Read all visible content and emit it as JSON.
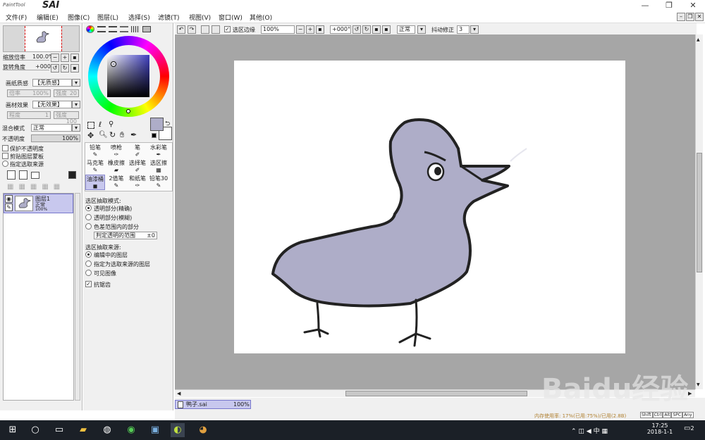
{
  "app": {
    "logo_small": "PaintTool",
    "logo_big": "SAI"
  },
  "window": {
    "min": "—",
    "restore": "❐",
    "close": "✕"
  },
  "menu": [
    "文件(F)",
    "编辑(E)",
    "图像(C)",
    "图层(L)",
    "选择(S)",
    "滤镜(T)",
    "视图(V)",
    "窗口(W)",
    "其他(O)"
  ],
  "navigator": {
    "zoom_label": "缩放倍率",
    "zoom_value": "100.0%",
    "rotate_label": "旋转角度",
    "rotate_value": "+000"
  },
  "paper": {
    "texture_label": "画纸质感",
    "texture_value": "【无质感】",
    "t_scale_label": "倍率",
    "t_scale_value": "100%",
    "t_strength_label": "强度",
    "t_strength_value": "20",
    "effect_label": "画材效果",
    "effect_value": "【无效果】",
    "e_degree_label": "程度",
    "e_degree_value": "1",
    "e_strength_label": "强度",
    "e_strength_value": "100"
  },
  "layer_props": {
    "blend_label": "混合模式",
    "blend_value": "正常",
    "opacity_label": "不透明度",
    "opacity_value": "100%",
    "opt1": "保护不透明度",
    "opt2": "剪贴图层蒙板",
    "opt3": "指定选取来源"
  },
  "layer": {
    "name": "图层1",
    "mode": "正常",
    "opacity": "100%"
  },
  "tools": [
    [
      "铅笔",
      "喷枪",
      "笔",
      "水彩笔"
    ],
    [
      "马克笔",
      "橡皮擦",
      "选择笔",
      "选区擦"
    ],
    [
      "油漆桶",
      "2值笔",
      "和纸笔",
      "铅笔30"
    ]
  ],
  "selection": {
    "mode_title": "选区抽取模式:",
    "mode1": "透明部分(精确)",
    "mode2": "透明部分(模糊)",
    "mode3": "色差范围内的部分",
    "range_label": "判定透明的范围",
    "range_value": "±0",
    "source_title": "选区抽取来源:",
    "src1": "编辑中的图层",
    "src2": "指定为选取来源的图层",
    "src3": "可见图像",
    "antialias": "抗锯齿"
  },
  "toolbar": {
    "sel_edge": "选区边缘",
    "zoom": "100%",
    "angle": "+000°",
    "mode": "正常",
    "stab_label": "抖动修正",
    "stab_value": "3"
  },
  "doc_tab": {
    "name": "鸭子.sai",
    "zoom": "100%"
  },
  "status": {
    "mem": "内存使用率: 17%(已用:75%)/已用(2.8B)",
    "btns": [
      "Shift",
      "Ctrl",
      "Alt",
      "SPC",
      "Any"
    ]
  },
  "taskbar": {
    "time": "17:25",
    "date": "2018-1-1",
    "ime": "中",
    "notify": "2"
  },
  "watermark": "Baidu经验",
  "colors": {
    "accent": "#c8c8ee",
    "canvas_bg": "#a6a6a6",
    "duck_body": "#aeadc8",
    "taskbar": "#1b2027"
  }
}
